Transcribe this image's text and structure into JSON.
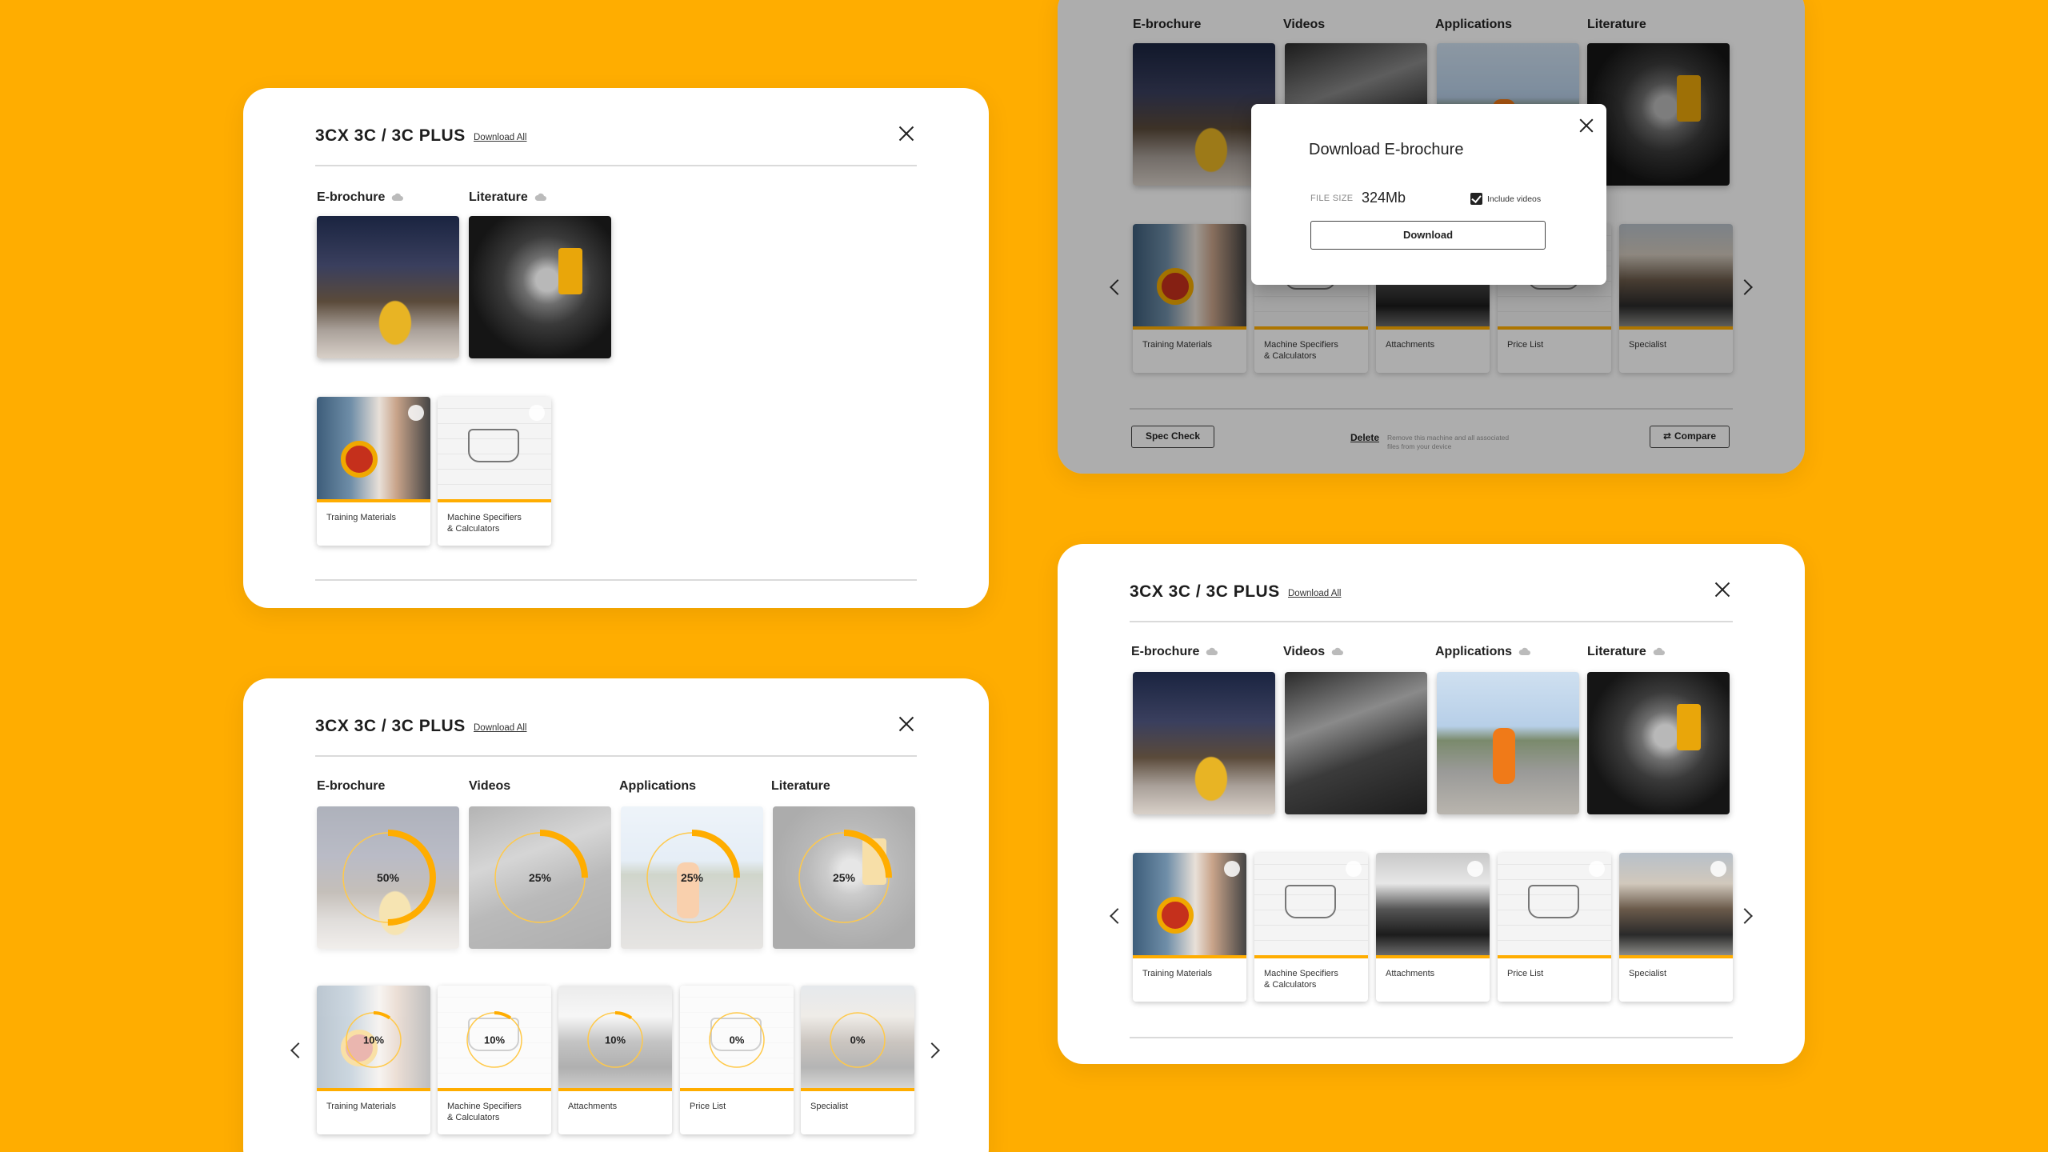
{
  "colors": {
    "background": "#FFAD00",
    "accent": "#FFAD00",
    "panel": "#FFFFFF"
  },
  "title": "3CX 3C / 3C PLUS",
  "download_all": "Download All",
  "categories": {
    "ebrochure": "E-brochure",
    "videos": "Videos",
    "applications": "Applications",
    "literature": "Literature"
  },
  "cards": {
    "training": "Training Materials",
    "specifiers_l1": "Machine Specifiers",
    "specifiers_l2": "& Calculators",
    "attachments": "Attachments",
    "price": "Price List",
    "specialist": "Specialist"
  },
  "footer": {
    "spec_check": "Spec Check",
    "delete": "Delete",
    "delete_note": "Remove this machine and all associated files from your device",
    "compare": "Compare"
  },
  "modal": {
    "title": "Download E-brochure",
    "file_size_label": "FILE SIZE",
    "file_size_value": "324Mb",
    "include_videos": "Include videos",
    "include_videos_checked": true,
    "download_button": "Download"
  },
  "progress": {
    "ebrochure": "50%",
    "videos": "25%",
    "applications": "25%",
    "literature": "25%",
    "training": "10%",
    "specifiers": "10%",
    "attachments": "10%",
    "price": "0%",
    "specialist": "0%"
  },
  "progress_values": {
    "ebrochure": 0.5,
    "videos": 0.25,
    "applications": 0.25,
    "literature": 0.25,
    "training": 0.1,
    "specifiers": 0.1,
    "attachments": 0.1,
    "price": 0,
    "specialist": 0
  },
  "icons": [
    "close-icon",
    "cloud-download-icon",
    "chevron-left-icon",
    "chevron-right-icon",
    "checkbox-icon",
    "compare-icon"
  ]
}
